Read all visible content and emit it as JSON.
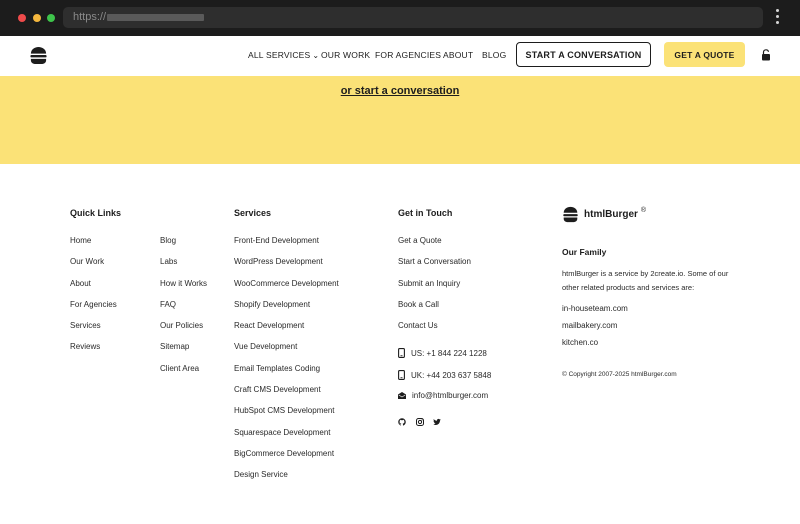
{
  "browser": {
    "url_prefix": "https://"
  },
  "header": {
    "nav": {
      "services": "ALL SERVICES",
      "work": "OUR WORK",
      "agencies": "FOR AGENCIES",
      "about": "ABOUT",
      "blog": "BLOG"
    },
    "cta_conversation": "START A CONVERSATION",
    "cta_quote": "GET A QUOTE"
  },
  "band": {
    "link": "or start a conversation"
  },
  "footer": {
    "quick_links": {
      "title": "Quick Links",
      "col1": [
        "Home",
        "Our Work",
        "About",
        "For Agencies",
        "Services",
        "Reviews"
      ],
      "col2": [
        "Blog",
        "Labs",
        "How it Works",
        "FAQ",
        "Our Policies",
        "Sitemap",
        "Client Area"
      ]
    },
    "services": {
      "title": "Services",
      "items": [
        "Front-End Development",
        "WordPress Development",
        "WooCommerce Development",
        "Shopify Development",
        "React Development",
        "Vue Development",
        "Email Templates Coding",
        "Craft CMS Development",
        "HubSpot CMS Development",
        "Squarespace Development",
        "BigCommerce Development",
        "Design Service"
      ]
    },
    "touch": {
      "title": "Get in Touch",
      "links": [
        "Get a Quote",
        "Start a Conversation",
        "Submit an Inquiry",
        "Book a Call",
        "Contact Us"
      ],
      "phone_us": "US: +1 844 224 1228",
      "phone_uk": "UK: +44 203 637 5848",
      "email": "info@htmlburger.com"
    },
    "brand": {
      "name": "htmlBurger",
      "reg": "®",
      "family_title": "Our Family",
      "family_desc": "htmlBurger is a service by 2create.io. Some of our other related products and services are:",
      "family_links": [
        "in-houseteam.com",
        "mailbakery.com",
        "kitchen.co"
      ],
      "copyright": "© Copyright 2007-2025 htmlBurger.com"
    }
  }
}
